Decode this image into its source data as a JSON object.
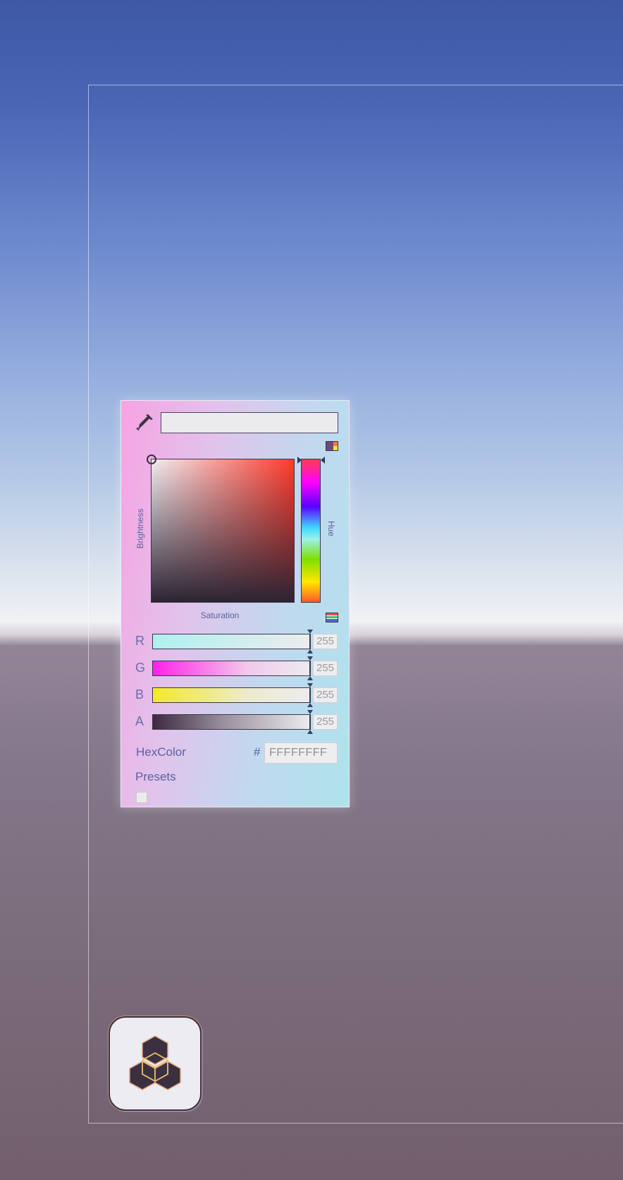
{
  "picker": {
    "labels": {
      "brightness": "Brightness",
      "hue": "Hue",
      "saturation": "Saturation"
    },
    "channels": [
      {
        "label": "R",
        "value": "255",
        "gradient": [
          "#aef0ef",
          "#ececee"
        ]
      },
      {
        "label": "G",
        "value": "255",
        "gradient": [
          "#ff22e8",
          "#ececee"
        ]
      },
      {
        "label": "B",
        "value": "255",
        "gradient": [
          "#f2ea2a",
          "#ececee"
        ]
      },
      {
        "label": "A",
        "value": "255",
        "gradient": [
          "#3d2a40",
          "#ececee"
        ]
      }
    ],
    "hex": {
      "label": "HexColor",
      "prefix": "#",
      "value": "FFFFFFFF"
    },
    "presets": {
      "label": "Presets",
      "items": [
        "#ececec"
      ]
    },
    "current_color": "#ebebee"
  },
  "icons": {
    "eyedropper": "eyedropper-icon",
    "mode_toggle_top": "color-mode-icon",
    "mode_toggle_sliders": "slider-mode-icon",
    "app": "cubes-icon"
  },
  "colors": {
    "accent_dark": "#3e344a",
    "label_text": "#5c60a0"
  }
}
